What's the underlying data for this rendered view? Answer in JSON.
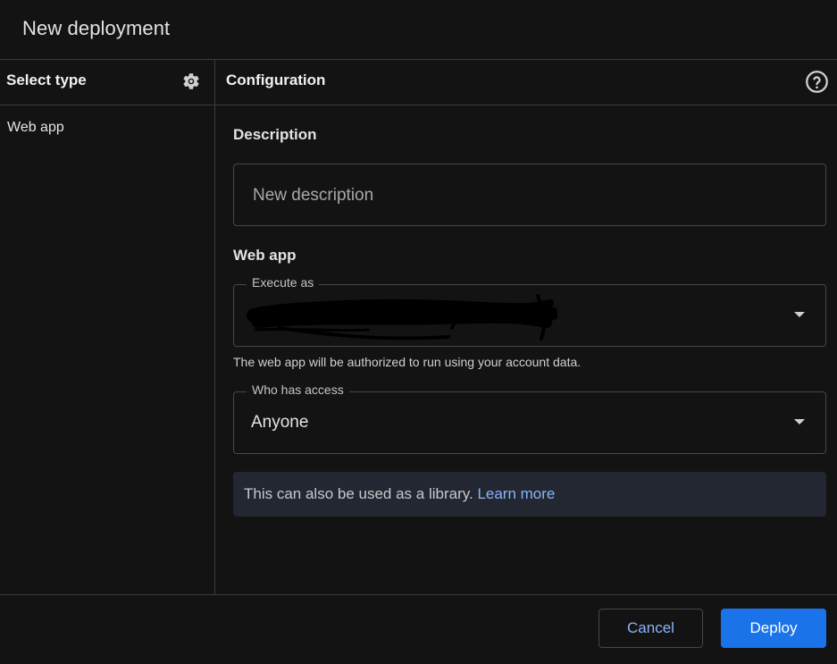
{
  "dialog": {
    "title": "New deployment"
  },
  "sidebar": {
    "heading": "Select type",
    "settings_icon": "gear-icon",
    "items": [
      {
        "label": "Web app"
      }
    ]
  },
  "config": {
    "heading": "Configuration",
    "help_icon": "help-circle-icon",
    "description": {
      "label": "Description",
      "placeholder": "New description",
      "value": ""
    },
    "web_app": {
      "label": "Web app",
      "execute_as": {
        "label": "Execute as",
        "value_redacted": true
      },
      "hint": "The web app will be authorized to run using your account data.",
      "who_has_access": {
        "label": "Who has access",
        "value": "Anyone"
      }
    },
    "info": {
      "text": "This can also be used as a library.",
      "link": "Learn more"
    }
  },
  "footer": {
    "cancel_label": "Cancel",
    "deploy_label": "Deploy"
  },
  "colors": {
    "background": "#131314",
    "primary_button": "#1a73e8",
    "link": "#8ab4f8",
    "info_box": "#232731"
  }
}
